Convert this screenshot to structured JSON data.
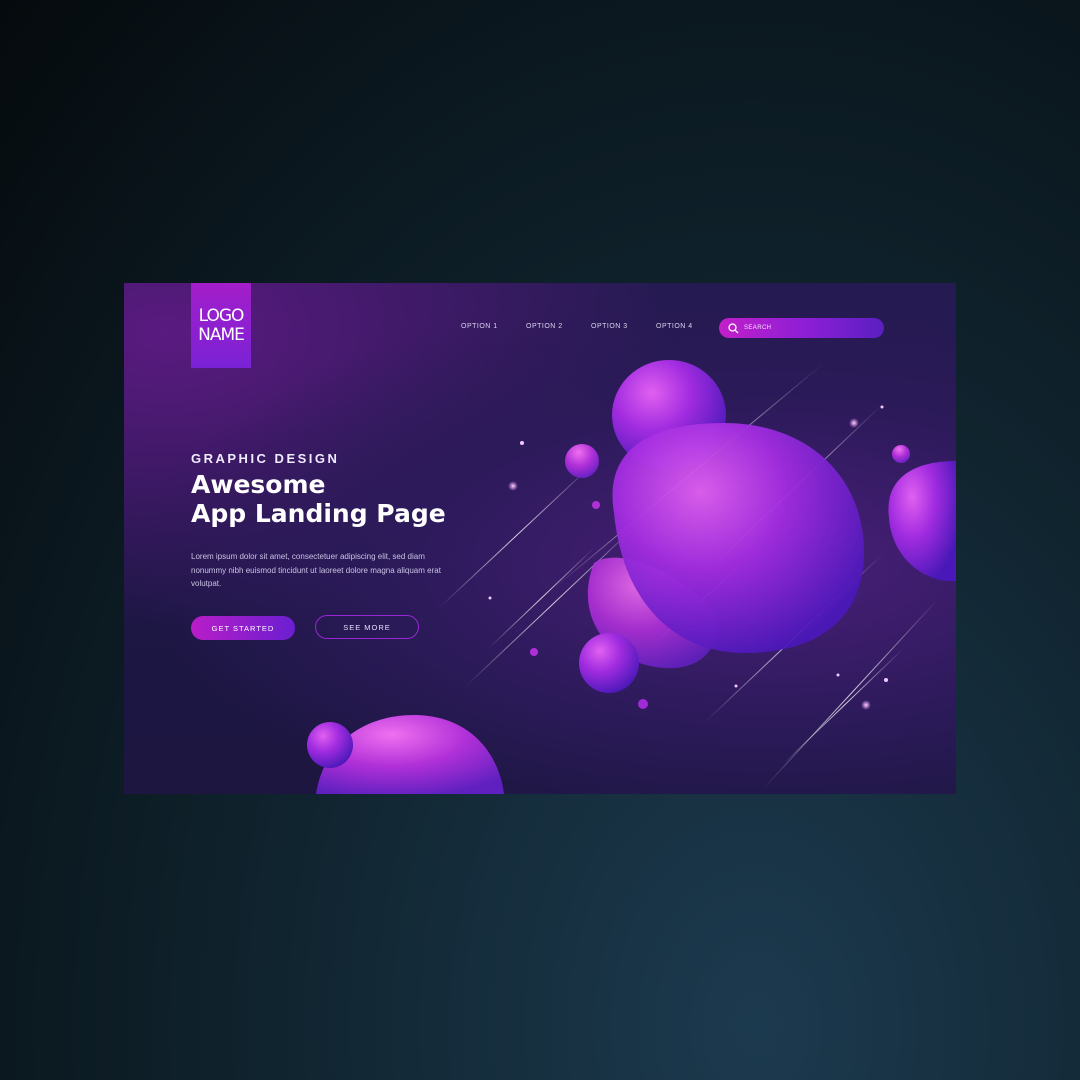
{
  "logo": {
    "line1": "LOGO",
    "line2": "NAME"
  },
  "nav": {
    "items": [
      {
        "label": "OPTION 1"
      },
      {
        "label": "OPTION 2"
      },
      {
        "label": "OPTION 3"
      },
      {
        "label": "OPTION 4"
      }
    ]
  },
  "search": {
    "placeholder": "SEARCH",
    "icon": "search-icon"
  },
  "hero": {
    "eyebrow": "GRAPHIC DESIGN",
    "title_line1": "Awesome",
    "title_line2": "App Landing Page",
    "body": "Lorem ipsum dolor sit amet, consectetuer adipiscing elit, sed diam nonummy nibh euismod tincidunt ut laoreet dolore magna aliquam erat volutpat.",
    "primary_button": "GET STARTED",
    "secondary_button": "SEE MORE"
  },
  "colors": {
    "accent_magenta": "#b81dc8",
    "accent_violet": "#6a1fd0",
    "page_bg": "#1d1745",
    "outer_bg": "#10242f"
  }
}
